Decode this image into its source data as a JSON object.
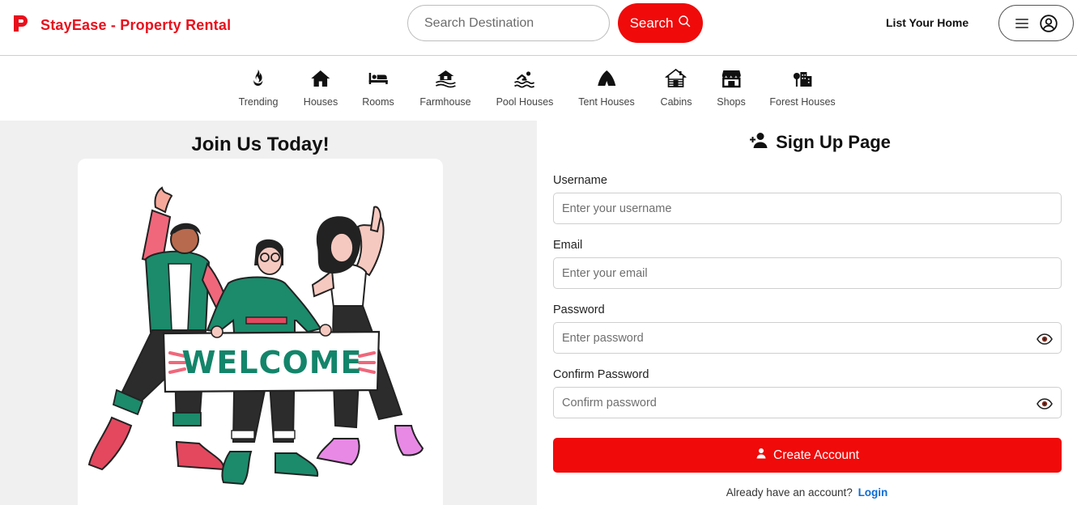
{
  "header": {
    "brand": "StayEase - Property Rental",
    "search_placeholder": "Search Destination",
    "search_button": "Search",
    "list_home": "List Your Home",
    "brand_color": "#e8101c"
  },
  "categories": [
    {
      "label": "Trending",
      "icon": "fire-icon"
    },
    {
      "label": "Houses",
      "icon": "house-icon"
    },
    {
      "label": "Rooms",
      "icon": "bed-icon"
    },
    {
      "label": "Farmhouse",
      "icon": "farmhouse-icon"
    },
    {
      "label": "Pool Houses",
      "icon": "swimmer-icon"
    },
    {
      "label": "Tent Houses",
      "icon": "tent-icon"
    },
    {
      "label": "Cabins",
      "icon": "cabin-icon"
    },
    {
      "label": "Shops",
      "icon": "shop-icon"
    },
    {
      "label": "Forest Houses",
      "icon": "forest-building-icon"
    }
  ],
  "left": {
    "title": "Join Us Today!",
    "banner_text": "WELCOME"
  },
  "form": {
    "title": "Sign Up Page",
    "username_label": "Username",
    "username_placeholder": "Enter your username",
    "email_label": "Email",
    "email_placeholder": "Enter your email",
    "password_label": "Password",
    "password_placeholder": "Enter password",
    "confirm_label": "Confirm Password",
    "confirm_placeholder": "Confirm password",
    "submit": "Create Account",
    "login_prompt": "Already have an account?",
    "login_link": "Login"
  },
  "colors": {
    "accent": "#f00a0a",
    "link": "#0b6bd6",
    "panel_bg": "#f0f0f0"
  }
}
